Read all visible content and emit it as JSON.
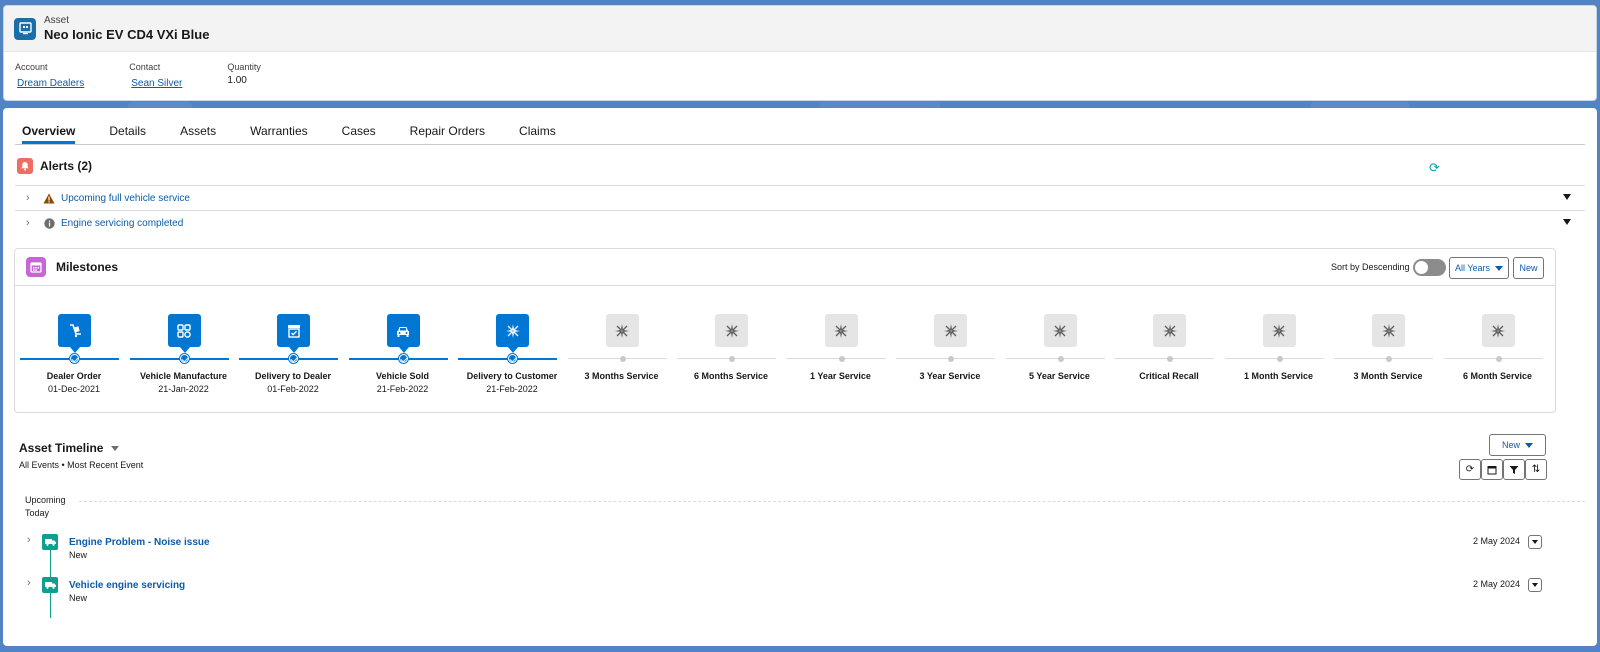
{
  "header": {
    "object_type": "Asset",
    "record_title": "Neo Ionic EV CD4 VXi Blue",
    "fields": [
      {
        "label": "Account",
        "value": "Dream Dealers"
      },
      {
        "label": "Contact",
        "value": "Sean Silver"
      },
      {
        "label": "Quantity",
        "value": "1.00"
      }
    ]
  },
  "tabs": [
    "Overview",
    "Details",
    "Assets",
    "Warranties",
    "Cases",
    "Repair Orders",
    "Claims"
  ],
  "alerts": {
    "title": "Alerts (2)",
    "items": [
      {
        "label": "Upcoming full vehicle service",
        "icon": "warning-icon"
      },
      {
        "label": "Engine servicing completed",
        "icon": "info-icon"
      }
    ]
  },
  "milestones": {
    "title": "Milestones",
    "sort_label": "Sort by Descending",
    "filter_label": "All Years",
    "new_label": "New",
    "items": [
      {
        "name": "Dealer Order",
        "date": "01-Dec-2021",
        "status": "done",
        "icon": "order-icon"
      },
      {
        "name": "Vehicle Manufacture",
        "date": "21-Jan-2022",
        "status": "done",
        "icon": "apps-icon"
      },
      {
        "name": "Delivery to Dealer",
        "date": "01-Feb-2022",
        "status": "done",
        "icon": "package-icon"
      },
      {
        "name": "Vehicle Sold",
        "date": "21-Feb-2022",
        "status": "done",
        "icon": "car-icon"
      },
      {
        "name": "Delivery to Customer",
        "date": "21-Feb-2022",
        "status": "done",
        "icon": "sparkle-icon"
      },
      {
        "name": "3 Months Service",
        "date": "",
        "status": "pending",
        "icon": "sparkle-icon"
      },
      {
        "name": "6 Months Service",
        "date": "",
        "status": "pending",
        "icon": "sparkle-icon"
      },
      {
        "name": "1 Year Service",
        "date": "",
        "status": "pending",
        "icon": "sparkle-icon"
      },
      {
        "name": "3 Year Service",
        "date": "",
        "status": "pending",
        "icon": "sparkle-icon"
      },
      {
        "name": "5 Year Service",
        "date": "",
        "status": "pending",
        "icon": "sparkle-icon"
      },
      {
        "name": "Critical Recall",
        "date": "",
        "status": "pending",
        "icon": "sparkle-icon"
      },
      {
        "name": "1 Month Service",
        "date": "",
        "status": "pending",
        "icon": "sparkle-icon"
      },
      {
        "name": "3 Month Service",
        "date": "",
        "status": "pending",
        "icon": "sparkle-icon"
      },
      {
        "name": "6 Month Service",
        "date": "",
        "status": "pending",
        "icon": "sparkle-icon"
      }
    ]
  },
  "timeline": {
    "title": "Asset Timeline",
    "subtitle": "All Events • Most Recent Event",
    "new_label": "New",
    "upcoming_label": "Upcoming",
    "today_label": "Today",
    "items": [
      {
        "name": "Engine Problem - Noise issue",
        "status": "New",
        "date": "2 May 2024"
      },
      {
        "name": "Vehicle engine servicing",
        "status": "New",
        "date": "2 May 2024"
      }
    ]
  },
  "colors": {
    "brand": "#0176d3",
    "link": "#0b5cab",
    "timeline_teal": "#0f9e8f",
    "alert_red": "#ef6e64",
    "milestone_purple": "#c865d4"
  }
}
